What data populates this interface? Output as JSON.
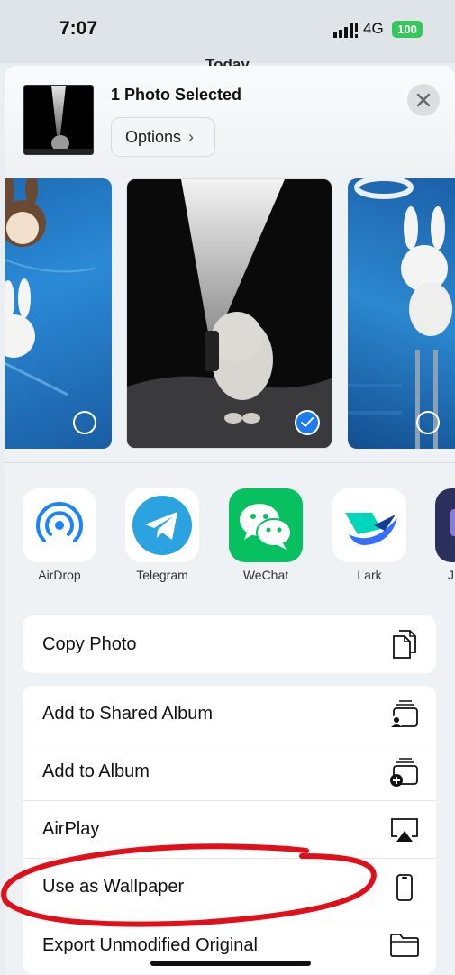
{
  "status_bar": {
    "time": "7:07",
    "network": "4G",
    "battery": "100"
  },
  "background": {
    "title": "Today"
  },
  "header": {
    "title": "1 Photo Selected",
    "options_label": "Options"
  },
  "apps": [
    {
      "label": "AirDrop",
      "icon": "airdrop-icon",
      "color": "#1a84ff"
    },
    {
      "label": "Telegram",
      "icon": "telegram-icon",
      "color": "#2aa3e0"
    },
    {
      "label": "WeChat",
      "icon": "wechat-icon",
      "color": "#07c160"
    },
    {
      "label": "Lark",
      "icon": "lark-icon",
      "color": "#3370ff"
    },
    {
      "label": "J",
      "icon": "app-icon",
      "color": "#2b2f5c"
    }
  ],
  "actions_group1": [
    {
      "label": "Copy Photo",
      "icon": "copy-icon"
    }
  ],
  "actions_group2": [
    {
      "label": "Add to Shared Album",
      "icon": "shared-album-icon"
    },
    {
      "label": "Add to Album",
      "icon": "add-album-icon"
    },
    {
      "label": "AirPlay",
      "icon": "airplay-icon"
    },
    {
      "label": "Use as Wallpaper",
      "icon": "phone-icon"
    },
    {
      "label": "Export Unmodified Original",
      "icon": "folder-icon"
    }
  ],
  "colors": {
    "accent": "#1e7cf2",
    "annotation": "#e0101a",
    "battery": "#34c759"
  }
}
